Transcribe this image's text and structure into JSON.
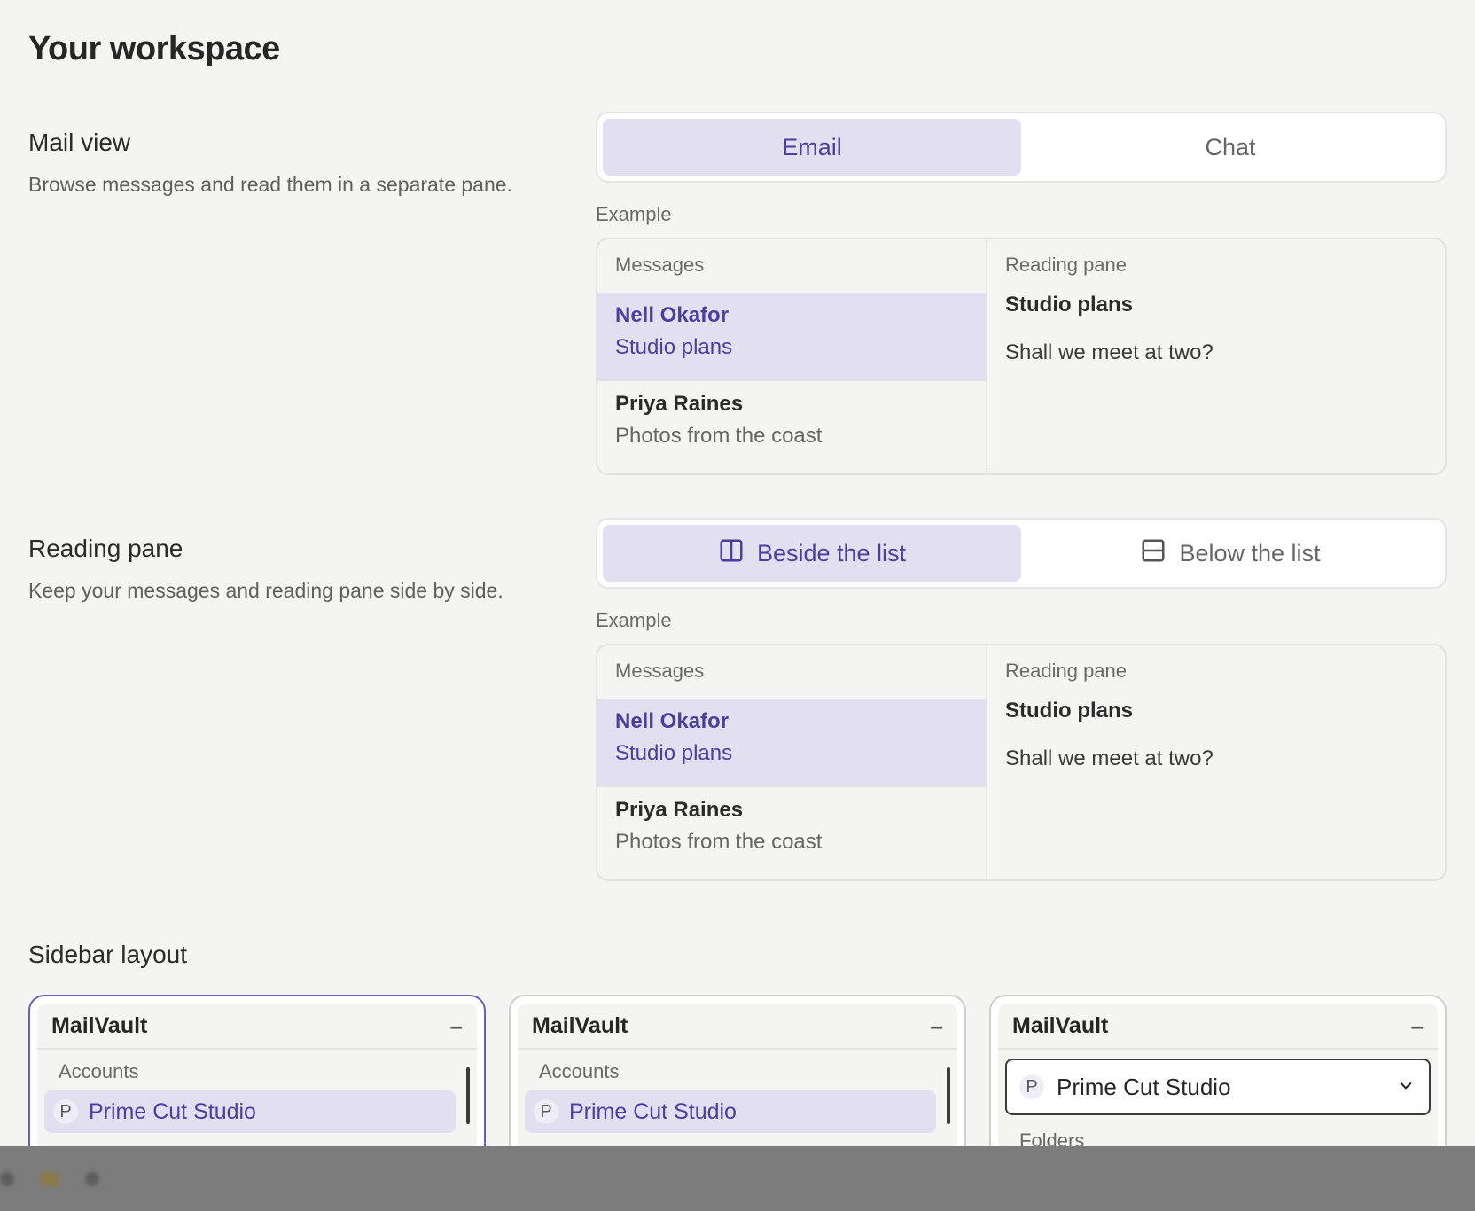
{
  "page": {
    "title": "Your workspace"
  },
  "mail_view": {
    "title": "Mail view",
    "description": "Browse messages and read them in a separate pane.",
    "options": [
      {
        "label": "Email",
        "selected": true
      },
      {
        "label": "Chat",
        "selected": false
      }
    ],
    "example_label": "Example"
  },
  "reading_pane": {
    "title": "Reading pane",
    "description": "Keep your messages and reading pane side by side.",
    "options": [
      {
        "label": "Beside the list",
        "icon": "columns-icon",
        "selected": true
      },
      {
        "label": "Below the list",
        "icon": "rows-icon",
        "selected": false
      }
    ],
    "example_label": "Example"
  },
  "preview": {
    "messages_header": "Messages",
    "reading_header": "Reading pane",
    "messages": [
      {
        "from": "Nell Okafor",
        "subject": "Studio plans",
        "selected": true
      },
      {
        "from": "Priya Raines",
        "subject": "Photos from the coast",
        "selected": false
      }
    ],
    "reading": {
      "subject": "Studio plans",
      "body": "Shall we meet at two?"
    }
  },
  "sidebar_layout": {
    "title": "Sidebar layout",
    "cards": [
      {
        "brand": "MailVault",
        "minimize": "–",
        "accounts_label": "Accounts",
        "account": "Prime Cut Studio",
        "avatar": "P",
        "selected": true
      },
      {
        "brand": "MailVault",
        "minimize": "–",
        "accounts_label": "Accounts",
        "account": "Prime Cut Studio",
        "avatar": "P",
        "selected": false
      },
      {
        "brand": "MailVault",
        "minimize": "–",
        "account": "Prime Cut Studio",
        "avatar": "P",
        "folders_label": "Folders",
        "selected": false
      }
    ]
  },
  "colors": {
    "accent": "#4a3f9c",
    "accent_bg": "#e2dff1",
    "background": "#f4f4f2"
  }
}
